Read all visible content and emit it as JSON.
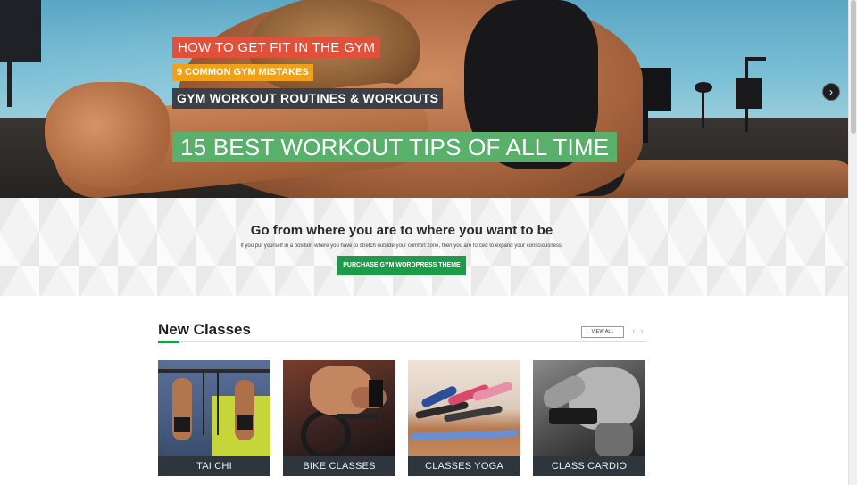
{
  "hero": {
    "tags": [
      "HOW TO GET FIT IN THE GYM",
      "9 COMMON GYM MISTAKES",
      "GYM WORKOUT ROUTINES & WORKOUTS",
      "15 BEST WORKOUT TIPS OF ALL TIME"
    ],
    "tag_colors": [
      "#e2503a",
      "#f2a116",
      "#3b3f47",
      "#58b06a"
    ],
    "next_icon": "chevron-right-icon",
    "next_glyph": "›"
  },
  "cta": {
    "title": "Go from where you are to where you want to be",
    "subtitle": "If you put yourself in a position where you have to stretch outside your comfort zone, then you are forced to expand your consciousness.",
    "button_label": "PURCHASE GYM WORDPRESS THEME",
    "button_color": "#1e9a4b"
  },
  "classes": {
    "title": "New Classes",
    "view_all_label": "VIEW ALL",
    "prev_glyph": "‹",
    "next_glyph": "›",
    "accent_color": "#1e9a4b",
    "items": [
      {
        "label": "TAI CHI"
      },
      {
        "label": "BIKE CLASSES"
      },
      {
        "label": "CLASSES YOGA"
      },
      {
        "label": "CLASS CARDIO"
      }
    ]
  }
}
